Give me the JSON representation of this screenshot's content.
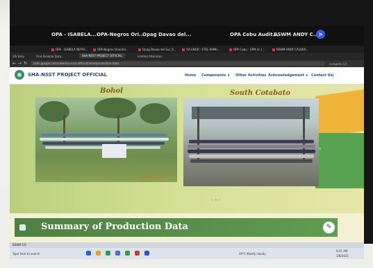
{
  "meeting": {
    "names": [
      "OPA - ISABELA...",
      "OPA-Negros Ori...",
      "Opag Davao del...",
      "OPA Cebu Audit...",
      "BSWM ANDY C..."
    ],
    "more_label": ">"
  },
  "bookmarks": [
    "OPA - ISABELA NEFFA...",
    "OPA-Negros Oriental...",
    "Opag Davao del Sur_S...",
    "OA ENGR - STEL RAMIL...",
    "OPA Cebu - GPM dr..I...",
    "BSWM ANDY CALDER..."
  ],
  "tabs": {
    "items": [
      "SIS Kelly",
      "Find Reliable Data...",
      "SHA-NSST PROJECT OFFICIAL",
      "Limited Alteration"
    ],
    "active_index": 2
  },
  "address": {
    "url": "sites.google.com/view/ssa-nsst-official/home/production-data",
    "profile_label": "Incognito (2)"
  },
  "site": {
    "title": "SHA-NSST PROJECT OFFICIAL",
    "menu": [
      "Home",
      "Components ∨",
      "Other Activities",
      "Acknowledgement ∨",
      "Contact Us"
    ]
  },
  "hero": {
    "left_label": "Bohol",
    "right_label": "South Cotabato",
    "photo_stamp": "2021/09/08 09:59",
    "slide_count": 3,
    "active_slide": 2
  },
  "summary": {
    "title": "Summary of Production Data"
  },
  "taskbar": {
    "window_label": "BSWM CO",
    "search_label": "Type here to search",
    "weather": "29°C  Mostly cloudy",
    "time": "9:51 AM",
    "date": "1/8/2021"
  },
  "colors": {
    "accent_blue": "#3a55e8",
    "site_nav_blue": "#1a4f86",
    "summary_green": "#5f9d50",
    "label_brown": "#8a5a1e",
    "stripe_orange": "#f0b33a"
  }
}
